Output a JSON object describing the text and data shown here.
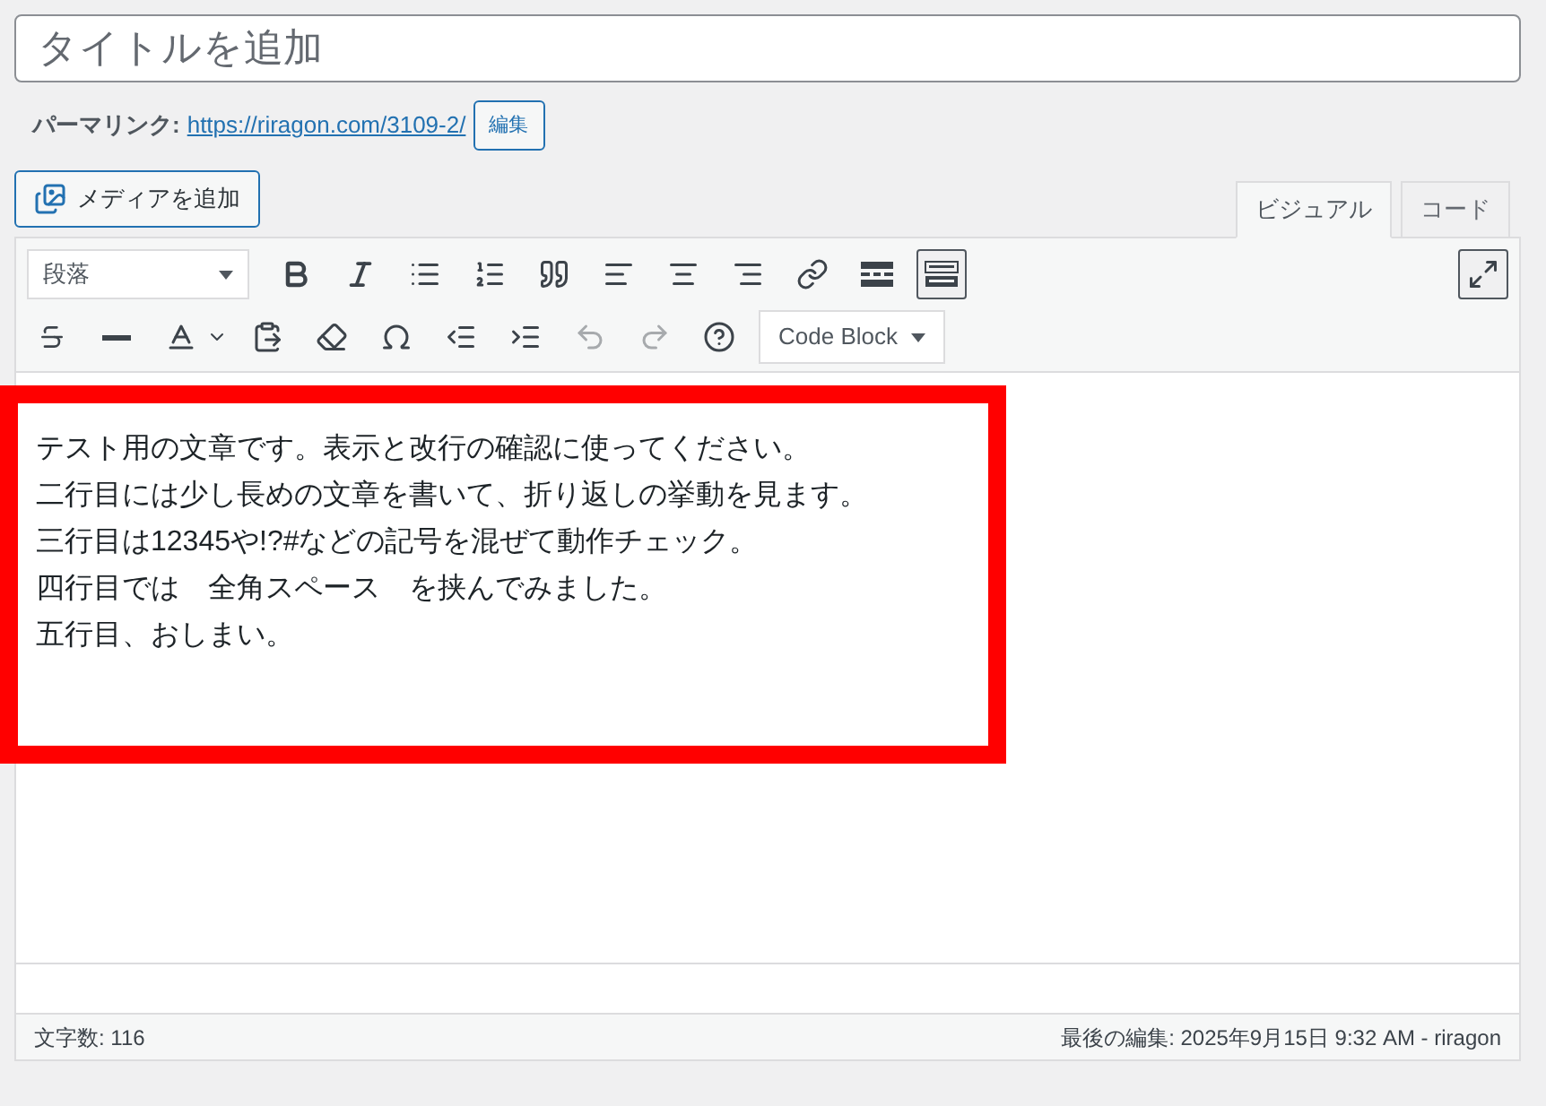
{
  "title_field": {
    "placeholder": "タイトルを追加"
  },
  "permalink": {
    "label": "パーマリンク:",
    "url": "https://riragon.com/3109-2/",
    "edit_button": "編集"
  },
  "media_button": "メディアを追加",
  "tabs": [
    {
      "label": "ビジュアル",
      "selected": true
    },
    {
      "label": "コード",
      "selected": false
    }
  ],
  "format_select": "段落",
  "toolbar_toggle": {
    "pressed": true
  },
  "undo": {
    "disabled": true
  },
  "redo": {
    "disabled": true
  },
  "code_block_select": "Code Block",
  "content": [
    "テスト用の文章です。表示と改行の確認に使ってください。",
    "二行目には少し長めの文章を書いて、折り返しの挙動を見ます。",
    "三行目は12345や!?#などの記号を混ぜて動作チェック。",
    "四行目では　全角スペース　を挟んでみました。",
    "五行目、おしまい。"
  ],
  "status_bar": {
    "word_count": "文字数: 116",
    "last_edited": "最後の編集: 2025年9月15日 9:32 AM - riragon"
  }
}
